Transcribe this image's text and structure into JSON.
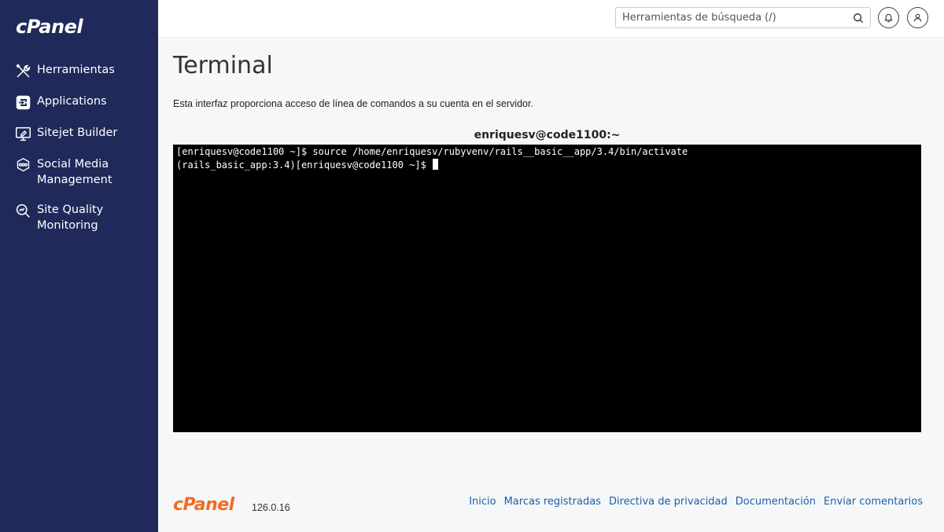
{
  "sidebar": {
    "logo": "cPanel",
    "items": [
      {
        "label": "Herramientas",
        "icon": "tools-icon"
      },
      {
        "label": "Applications",
        "icon": "applications-icon"
      },
      {
        "label": "Sitejet Builder",
        "icon": "monitor-edit-icon"
      },
      {
        "label": "Social Media Management",
        "icon": "social-media-icon"
      },
      {
        "label": "Site Quality Monitoring",
        "icon": "magnifier-chart-icon"
      }
    ]
  },
  "header": {
    "search_placeholder": "Herramientas de búsqueda (/)",
    "icons": [
      "search-icon",
      "bell-icon",
      "user-icon"
    ]
  },
  "main": {
    "title": "Terminal",
    "description": "Esta interfaz proporciona acceso de línea de comandos a su cuenta en el servidor.",
    "terminal_title": "enriquesv@code1100:~",
    "terminal_lines": [
      "[enriquesv@code1100 ~]$ source /home/enriquesv/rubyvenv/rails__basic__app/3.4/bin/activate",
      "(rails_basic_app:3.4)[enriquesv@code1100 ~]$ "
    ]
  },
  "footer": {
    "logo": "cPanel",
    "version": "126.0.16",
    "links": [
      "Inicio",
      "Marcas registradas",
      "Directiva de privacidad",
      "Documentación",
      "Enviar comentarios"
    ]
  },
  "colors": {
    "sidebar_bg": "#1f2a5a",
    "accent_orange": "#f26b22",
    "link_blue": "#1d5fa8",
    "terminal_bg": "#000000"
  }
}
